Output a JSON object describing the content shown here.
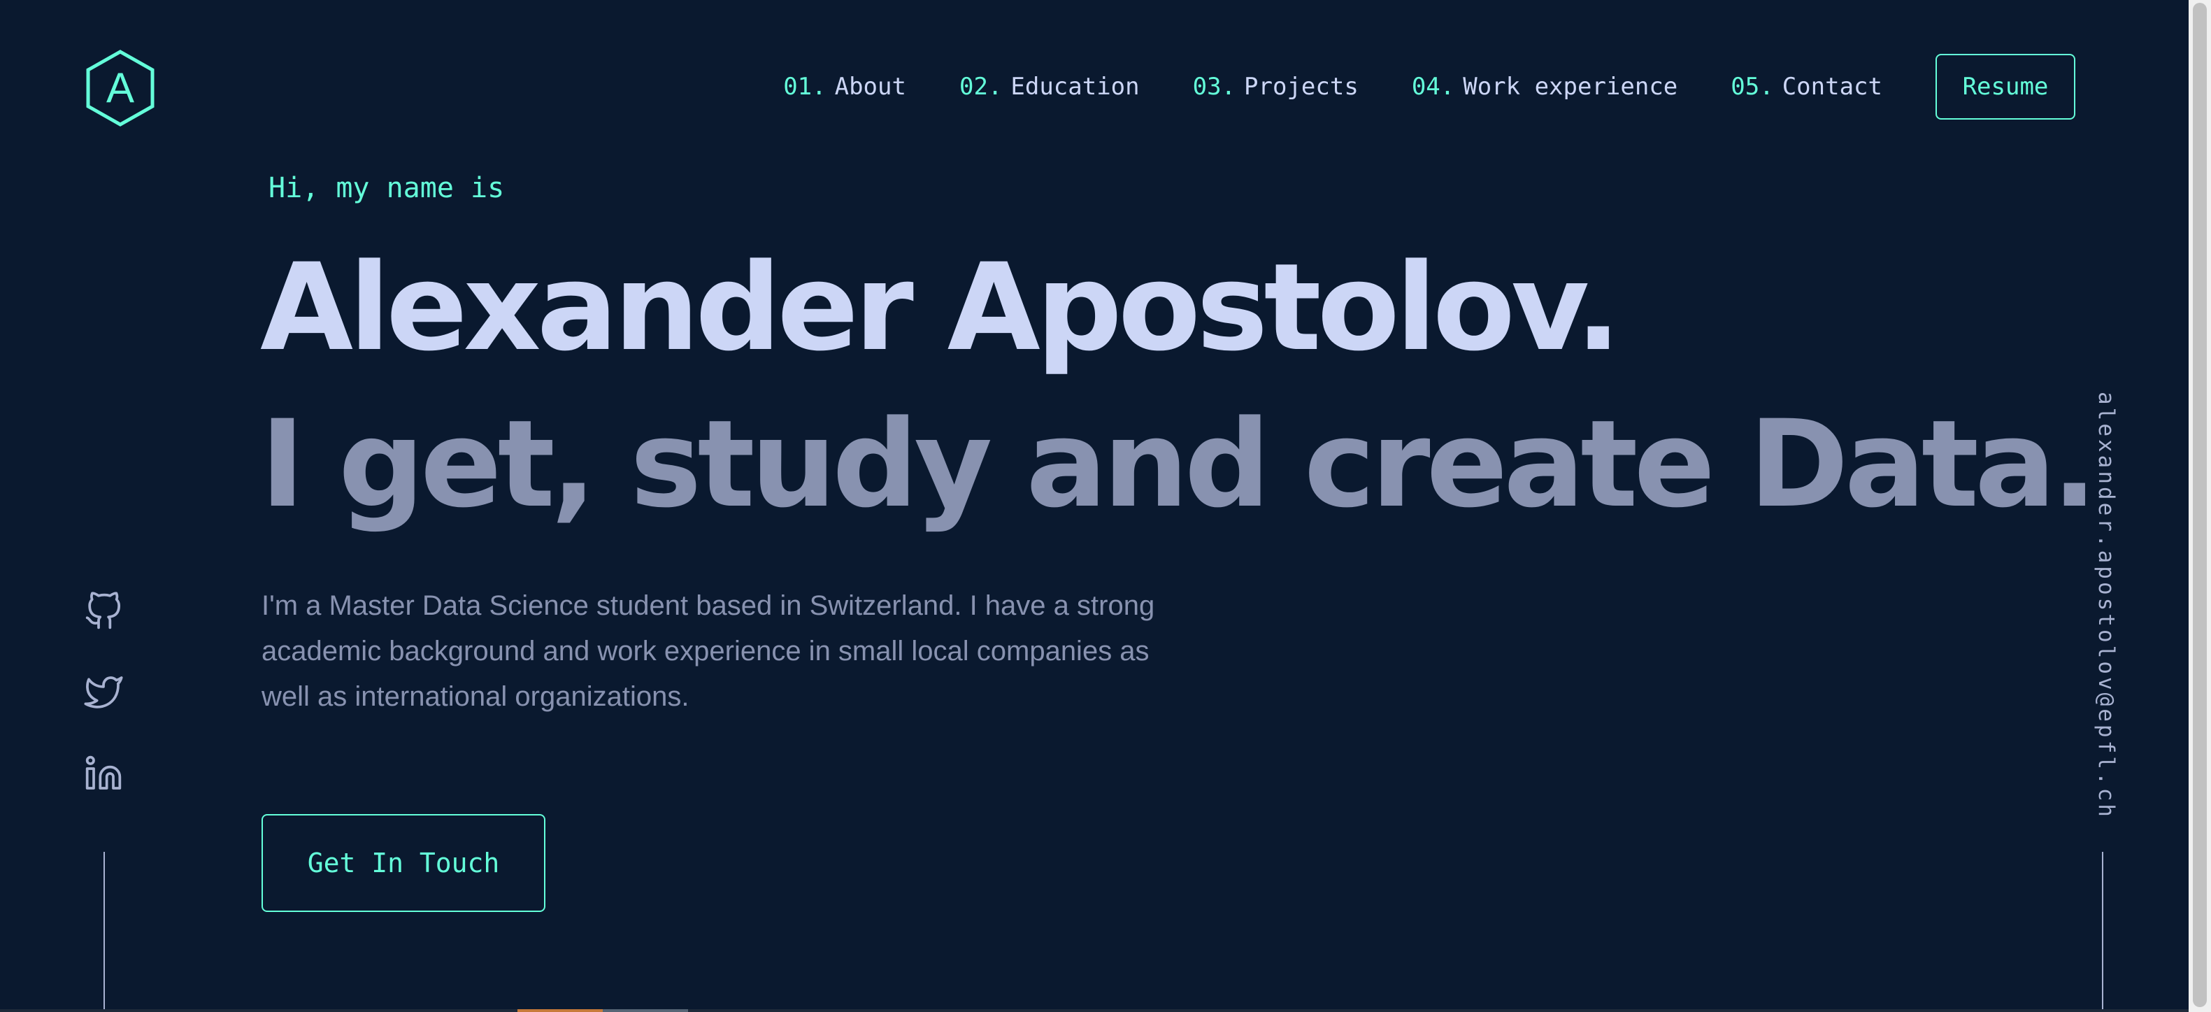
{
  "logo": {
    "letter": "A"
  },
  "nav": {
    "items": [
      {
        "num": "01.",
        "label": "About"
      },
      {
        "num": "02.",
        "label": "Education"
      },
      {
        "num": "03.",
        "label": "Projects"
      },
      {
        "num": "04.",
        "label": "Work experience"
      },
      {
        "num": "05.",
        "label": "Contact"
      }
    ],
    "resume_label": "Resume"
  },
  "hero": {
    "intro": "Hi, my name is",
    "name": "Alexander Apostolov.",
    "tagline": "I get, study and create Data.",
    "description": "I'm a Master Data Science student based in Switzerland. I have a strong academic background and work experience in small local companies as well as international organizations.",
    "cta_label": "Get In Touch"
  },
  "social": [
    "github-icon",
    "twitter-icon",
    "linkedin-icon"
  ],
  "email": "alexander.apostolov@epfl.ch",
  "colors": {
    "background": "#0a192f",
    "accent": "#64ffda",
    "heading": "#ccd6f6",
    "muted": "#8892b0"
  }
}
